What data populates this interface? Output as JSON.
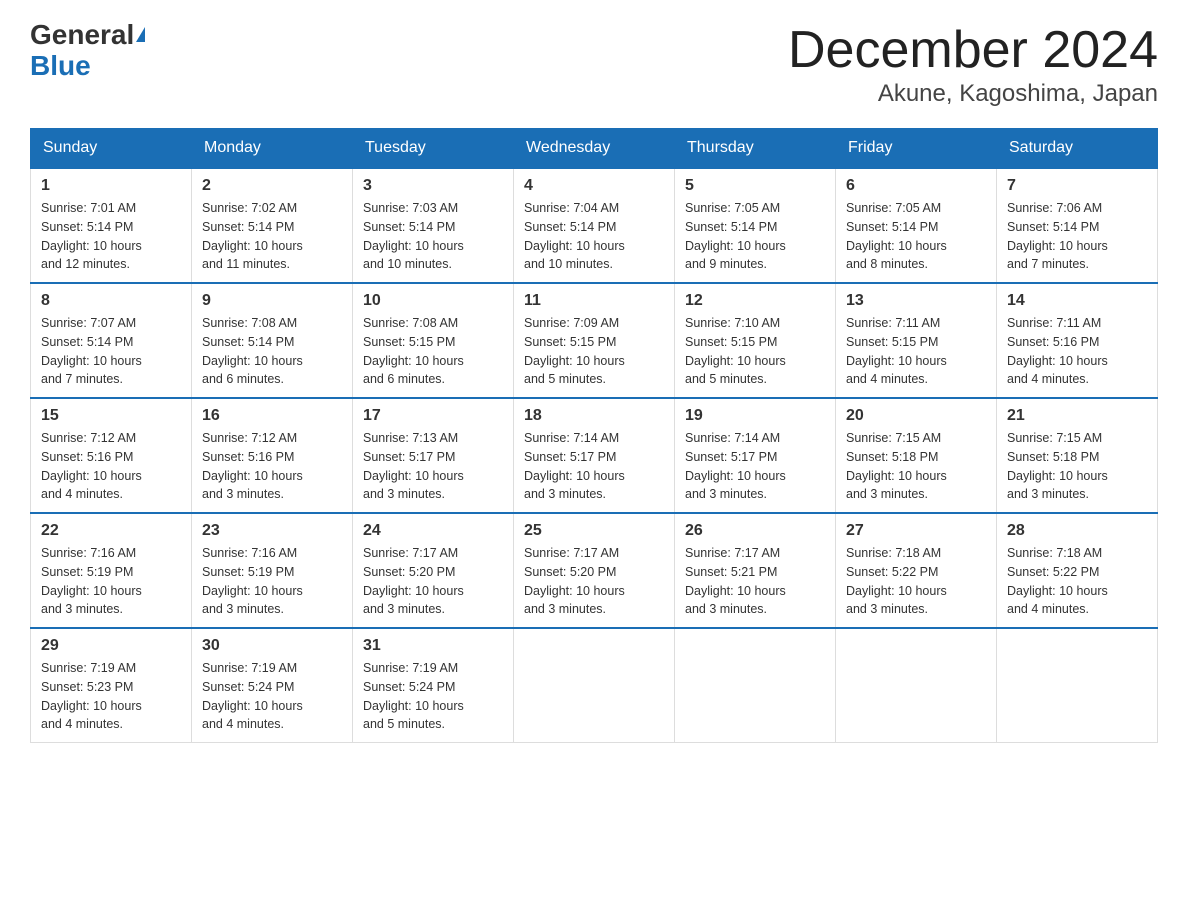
{
  "logo": {
    "general": "General",
    "blue": "Blue"
  },
  "title": "December 2024",
  "subtitle": "Akune, Kagoshima, Japan",
  "weekdays": [
    "Sunday",
    "Monday",
    "Tuesday",
    "Wednesday",
    "Thursday",
    "Friday",
    "Saturday"
  ],
  "weeks": [
    [
      {
        "day": "1",
        "sunrise": "7:01 AM",
        "sunset": "5:14 PM",
        "daylight": "10 hours and 12 minutes."
      },
      {
        "day": "2",
        "sunrise": "7:02 AM",
        "sunset": "5:14 PM",
        "daylight": "10 hours and 11 minutes."
      },
      {
        "day": "3",
        "sunrise": "7:03 AM",
        "sunset": "5:14 PM",
        "daylight": "10 hours and 10 minutes."
      },
      {
        "day": "4",
        "sunrise": "7:04 AM",
        "sunset": "5:14 PM",
        "daylight": "10 hours and 10 minutes."
      },
      {
        "day": "5",
        "sunrise": "7:05 AM",
        "sunset": "5:14 PM",
        "daylight": "10 hours and 9 minutes."
      },
      {
        "day": "6",
        "sunrise": "7:05 AM",
        "sunset": "5:14 PM",
        "daylight": "10 hours and 8 minutes."
      },
      {
        "day": "7",
        "sunrise": "7:06 AM",
        "sunset": "5:14 PM",
        "daylight": "10 hours and 7 minutes."
      }
    ],
    [
      {
        "day": "8",
        "sunrise": "7:07 AM",
        "sunset": "5:14 PM",
        "daylight": "10 hours and 7 minutes."
      },
      {
        "day": "9",
        "sunrise": "7:08 AM",
        "sunset": "5:14 PM",
        "daylight": "10 hours and 6 minutes."
      },
      {
        "day": "10",
        "sunrise": "7:08 AM",
        "sunset": "5:15 PM",
        "daylight": "10 hours and 6 minutes."
      },
      {
        "day": "11",
        "sunrise": "7:09 AM",
        "sunset": "5:15 PM",
        "daylight": "10 hours and 5 minutes."
      },
      {
        "day": "12",
        "sunrise": "7:10 AM",
        "sunset": "5:15 PM",
        "daylight": "10 hours and 5 minutes."
      },
      {
        "day": "13",
        "sunrise": "7:11 AM",
        "sunset": "5:15 PM",
        "daylight": "10 hours and 4 minutes."
      },
      {
        "day": "14",
        "sunrise": "7:11 AM",
        "sunset": "5:16 PM",
        "daylight": "10 hours and 4 minutes."
      }
    ],
    [
      {
        "day": "15",
        "sunrise": "7:12 AM",
        "sunset": "5:16 PM",
        "daylight": "10 hours and 4 minutes."
      },
      {
        "day": "16",
        "sunrise": "7:12 AM",
        "sunset": "5:16 PM",
        "daylight": "10 hours and 3 minutes."
      },
      {
        "day": "17",
        "sunrise": "7:13 AM",
        "sunset": "5:17 PM",
        "daylight": "10 hours and 3 minutes."
      },
      {
        "day": "18",
        "sunrise": "7:14 AM",
        "sunset": "5:17 PM",
        "daylight": "10 hours and 3 minutes."
      },
      {
        "day": "19",
        "sunrise": "7:14 AM",
        "sunset": "5:17 PM",
        "daylight": "10 hours and 3 minutes."
      },
      {
        "day": "20",
        "sunrise": "7:15 AM",
        "sunset": "5:18 PM",
        "daylight": "10 hours and 3 minutes."
      },
      {
        "day": "21",
        "sunrise": "7:15 AM",
        "sunset": "5:18 PM",
        "daylight": "10 hours and 3 minutes."
      }
    ],
    [
      {
        "day": "22",
        "sunrise": "7:16 AM",
        "sunset": "5:19 PM",
        "daylight": "10 hours and 3 minutes."
      },
      {
        "day": "23",
        "sunrise": "7:16 AM",
        "sunset": "5:19 PM",
        "daylight": "10 hours and 3 minutes."
      },
      {
        "day": "24",
        "sunrise": "7:17 AM",
        "sunset": "5:20 PM",
        "daylight": "10 hours and 3 minutes."
      },
      {
        "day": "25",
        "sunrise": "7:17 AM",
        "sunset": "5:20 PM",
        "daylight": "10 hours and 3 minutes."
      },
      {
        "day": "26",
        "sunrise": "7:17 AM",
        "sunset": "5:21 PM",
        "daylight": "10 hours and 3 minutes."
      },
      {
        "day": "27",
        "sunrise": "7:18 AM",
        "sunset": "5:22 PM",
        "daylight": "10 hours and 3 minutes."
      },
      {
        "day": "28",
        "sunrise": "7:18 AM",
        "sunset": "5:22 PM",
        "daylight": "10 hours and 4 minutes."
      }
    ],
    [
      {
        "day": "29",
        "sunrise": "7:19 AM",
        "sunset": "5:23 PM",
        "daylight": "10 hours and 4 minutes."
      },
      {
        "day": "30",
        "sunrise": "7:19 AM",
        "sunset": "5:24 PM",
        "daylight": "10 hours and 4 minutes."
      },
      {
        "day": "31",
        "sunrise": "7:19 AM",
        "sunset": "5:24 PM",
        "daylight": "10 hours and 5 minutes."
      },
      null,
      null,
      null,
      null
    ]
  ],
  "labels": {
    "sunrise": "Sunrise:",
    "sunset": "Sunset:",
    "daylight": "Daylight:"
  }
}
